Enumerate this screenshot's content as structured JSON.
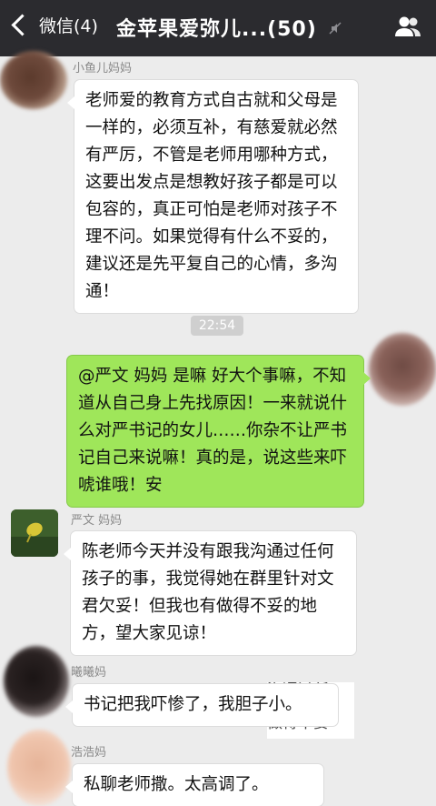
{
  "header": {
    "back_label": "微信(4)",
    "title": "金苹果爱弥儿...(50)"
  },
  "messages": [
    {
      "sender": "小鱼儿妈妈",
      "text": "老师爱的教育方式自古就和父母是一样的，必须互补，有慈爱就必然有严厉，不管是老师用哪种方式，这要出发点是想教好孩子都是可以包容的，真正可怕是老师对孩子不理不问。如果觉得有什么不妥的，建议还是先平复自己的心情，多沟通！"
    },
    {
      "time": "22:54"
    },
    {
      "sender": "me",
      "text": "@严文 妈妈 是嘛 好大个事嘛，不知道从自己身上先找原因！一来就说什么对严书记的女儿……你杂不让严书记自己来说嘛！真的是，说这些来吓唬谁哦！安"
    },
    {
      "sender": "严文 妈妈",
      "text": "陈老师今天并没有跟我沟通过任何孩子的事，我觉得她在群里针对文君欠妥！但我也有做得不妥的地方，望大家见谅！"
    },
    {
      "sender": "曦曦妈",
      "text": "书记把我吓惨了，我胆子小。"
    },
    {
      "sender": "浩浩妈",
      "text": "私聊老师撒。太高调了。"
    }
  ],
  "overlay_fragment": [
    "沟通过任",
    "在群里针",
    "做得不妥"
  ],
  "colors": {
    "header_bg": "#2b2b2f",
    "chat_bg": "#ececec",
    "my_bubble": "#9fe65a"
  }
}
